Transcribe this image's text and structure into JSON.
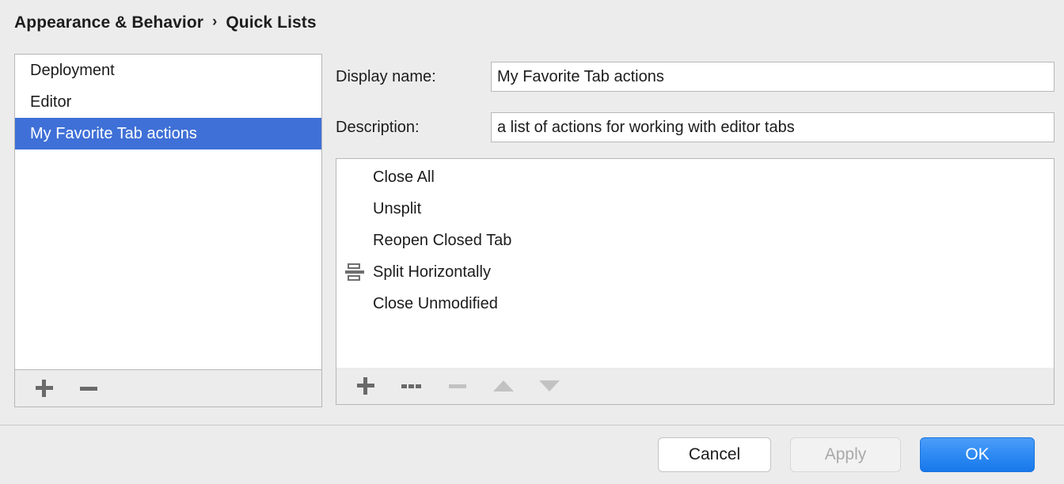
{
  "breadcrumb": {
    "parent": "Appearance & Behavior",
    "separator": "›",
    "current": "Quick Lists"
  },
  "quick_lists": {
    "items": [
      {
        "label": "Deployment",
        "selected": false
      },
      {
        "label": "Editor",
        "selected": false
      },
      {
        "label": "My Favorite Tab actions",
        "selected": true
      }
    ],
    "toolbar": [
      {
        "name": "add-quick-list-button",
        "icon": "plus-icon",
        "enabled": true
      },
      {
        "name": "remove-quick-list-button",
        "icon": "minus-icon",
        "enabled": true
      }
    ]
  },
  "details": {
    "display_name": {
      "label": "Display name:",
      "value": "My Favorite Tab actions",
      "placeholder": ""
    },
    "description": {
      "label": "Description:",
      "value": "a list of actions for working with editor tabs",
      "placeholder": ""
    }
  },
  "actions": {
    "items": [
      {
        "label": "Close All",
        "icon": ""
      },
      {
        "label": "Unsplit",
        "icon": ""
      },
      {
        "label": "Reopen Closed Tab",
        "icon": ""
      },
      {
        "label": "Split Horizontally",
        "icon": "split-horizontally-icon"
      },
      {
        "label": "Close Unmodified",
        "icon": ""
      }
    ],
    "toolbar": [
      {
        "name": "add-action-button",
        "icon": "plus-icon",
        "enabled": true
      },
      {
        "name": "add-separator-button",
        "icon": "separator-icon",
        "enabled": true
      },
      {
        "name": "remove-action-button",
        "icon": "minus-icon",
        "enabled": false
      },
      {
        "name": "move-up-button",
        "icon": "arrow-up-icon",
        "enabled": false
      },
      {
        "name": "move-down-button",
        "icon": "arrow-down-icon",
        "enabled": false
      }
    ]
  },
  "buttons": {
    "cancel": "Cancel",
    "apply": "Apply",
    "ok": "OK"
  },
  "colors": {
    "window_background": "#ececec",
    "selection_blue": "#3f70d7",
    "ok_button_blue": "#2f8bf4",
    "field_background": "#ffffff",
    "border": "#b6b6b6",
    "icon_enabled": "#6a6a6a",
    "icon_disabled": "#c2c2c2",
    "disabled_text": "#a9a9a9"
  }
}
